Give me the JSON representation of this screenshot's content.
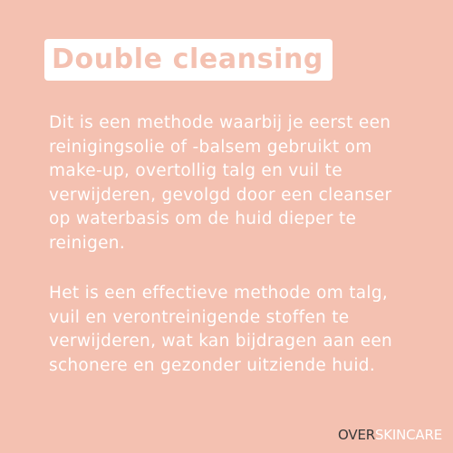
{
  "title": "Double cleansing",
  "paragraphs": [
    "Dit is een methode waarbij je eerst een\nreinigingsolie of -balsem gebruikt om\nmake-up, overtollig talg en vuil te\nverwijderen, gevolgd door een cleanser\nop waterbasis om de huid dieper te\nreinigen.",
    "Het is een effectieve methode om talg,\nvuil en verontreinigende stoffen te\nverwijderen, wat kan bijdragen aan een\nschonere en gezonder uitziende huid."
  ],
  "brand": {
    "part1": "OVER",
    "part2": "SKINCARE"
  },
  "colors": {
    "background": "#f4c1b1",
    "title_box": "#ffffff",
    "title_text": "#f4c1b1",
    "body_text": "#ffffff",
    "brand_dark": "#3a3a3a"
  }
}
